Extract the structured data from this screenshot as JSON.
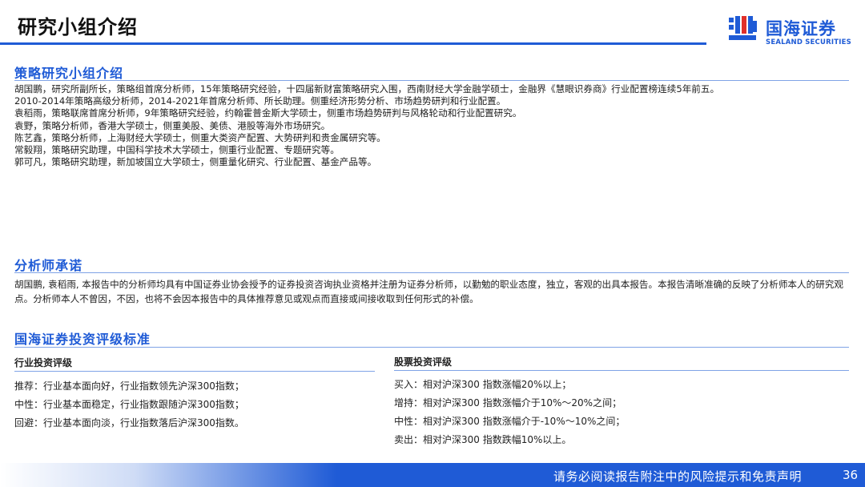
{
  "header": {
    "title": "研究小组介绍",
    "logo_cn": "国海证券",
    "logo_en": "SEALAND SECURITIES",
    "accent": "#1f5bd6"
  },
  "team": {
    "heading": "策略研究小组介绍",
    "lines": [
      "胡国鹏，研究所副所长，策略组首席分析师，15年策略研究经验，十四届新财富策略研究入围，西南财经大学金融学硕士，金融界《慧眼识券商》行业配置榜连续5年前五。",
      "2010-2014年策略高级分析师，2014-2021年首席分析师、所长助理。侧重经济形势分析、市场趋势研判和行业配置。",
      "袁稻雨，策略联席首席分析师，9年策略研究经验，约翰霍普金斯大学硕士，侧重市场趋势研判与风格轮动和行业配置研究。",
      "袁野，策略分析师，香港大学硕士，侧重美股、美债、港股等海外市场研究。",
      "陈艺鑫，策略分析师，上海财经大学硕士，侧重大类资产配置、大势研判和贵金属研究等。",
      "常毅翔，策略研究助理，中国科学技术大学硕士，侧重行业配置、专题研究等。",
      "郭可凡，策略研究助理，新加坡国立大学硕士，侧重量化研究、行业配置、基金产品等。"
    ]
  },
  "pledge": {
    "heading": "分析师承诺",
    "text": "胡国鹏, 袁稻雨, 本报告中的分析师均具有中国证券业协会授予的证券投资咨询执业资格并注册为证券分析师，以勤勉的职业态度，独立，客观的出具本报告。本报告清晰准确的反映了分析师本人的研究观点。分析师本人不曾因，不因，也将不会因本报告中的具体推荐意见或观点而直接或间接收取到任何形式的补偿。"
  },
  "rating": {
    "heading": "国海证券投资评级标准",
    "industry": {
      "title": "行业投资评级",
      "items": [
        "推荐：行业基本面向好，行业指数领先沪深300指数；",
        "中性：行业基本面稳定，行业指数跟随沪深300指数；",
        "回避：行业基本面向淡，行业指数落后沪深300指数。"
      ]
    },
    "stock": {
      "title": "股票投资评级",
      "items": [
        "买入：相对沪深300 指数涨幅20%以上；",
        "增持：相对沪深300 指数涨幅介于10%～20%之间；",
        "中性：相对沪深300 指数涨幅介于-10%～10%之间；",
        "卖出：相对沪深300 指数跌幅10%以上。"
      ]
    }
  },
  "footer": {
    "disclaimer": "请务必阅读报告附注中的风险提示和免责声明",
    "page": "36"
  }
}
